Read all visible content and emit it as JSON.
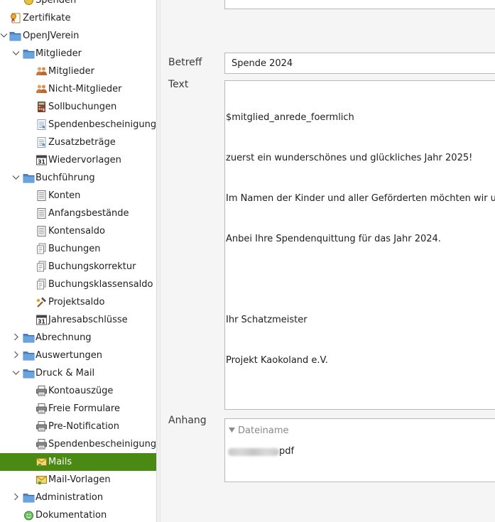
{
  "tree": {
    "items": [
      {
        "id": "spenden",
        "label": "Spenden",
        "icon": "money-icon",
        "level": 1,
        "expander": "none",
        "selected": false
      },
      {
        "id": "zertifikate",
        "label": "Zertifikate",
        "icon": "certificate-icon",
        "level": 0,
        "expander": "none",
        "selected": false
      },
      {
        "id": "openjverein",
        "label": "OpenJVerein",
        "icon": "folder-icon",
        "level": 0,
        "expander": "expanded",
        "selected": false
      },
      {
        "id": "mitglieder-folder",
        "label": "Mitglieder",
        "icon": "folder-icon",
        "level": 1,
        "expander": "expanded",
        "selected": false
      },
      {
        "id": "mitglieder",
        "label": "Mitglieder",
        "icon": "people-icon",
        "level": 2,
        "expander": "none",
        "selected": false
      },
      {
        "id": "nicht-mitglieder",
        "label": "Nicht-Mitglieder",
        "icon": "people-icon",
        "level": 2,
        "expander": "none",
        "selected": false
      },
      {
        "id": "sollbuchungen",
        "label": "Sollbuchungen",
        "icon": "calculator-icon",
        "level": 2,
        "expander": "none",
        "selected": false
      },
      {
        "id": "spendenbescheinigungen-1",
        "label": "Spendenbescheinigungen",
        "icon": "document-icon",
        "level": 2,
        "expander": "none",
        "selected": false
      },
      {
        "id": "zusatzbetraege",
        "label": "Zusatzbeträge",
        "icon": "document-icon",
        "level": 2,
        "expander": "none",
        "selected": false
      },
      {
        "id": "wiedervorlagen",
        "label": "Wiedervorlagen",
        "icon": "calendar-icon",
        "level": 2,
        "expander": "none",
        "selected": false
      },
      {
        "id": "buchfuehrung",
        "label": "Buchführung",
        "icon": "folder-icon",
        "level": 1,
        "expander": "expanded",
        "selected": false
      },
      {
        "id": "konten",
        "label": "Konten",
        "icon": "ledger-icon",
        "level": 2,
        "expander": "none",
        "selected": false
      },
      {
        "id": "anfangsbestaende",
        "label": "Anfangsbestände",
        "icon": "ledger-icon",
        "level": 2,
        "expander": "none",
        "selected": false
      },
      {
        "id": "kontensaldo",
        "label": "Kontensaldo",
        "icon": "ledger-icon",
        "level": 2,
        "expander": "none",
        "selected": false
      },
      {
        "id": "buchungen",
        "label": "Buchungen",
        "icon": "pages-icon",
        "level": 2,
        "expander": "none",
        "selected": false
      },
      {
        "id": "buchungskorrektur",
        "label": "Buchungskorrektur",
        "icon": "pages-icon",
        "level": 2,
        "expander": "none",
        "selected": false
      },
      {
        "id": "buchungsklassensaldo",
        "label": "Buchungsklassensaldo",
        "icon": "pages-icon",
        "level": 2,
        "expander": "none",
        "selected": false
      },
      {
        "id": "projektsaldo",
        "label": "Projektsaldo",
        "icon": "hammer-icon",
        "level": 2,
        "expander": "none",
        "selected": false
      },
      {
        "id": "jahresabschluesse",
        "label": "Jahresabschlüsse",
        "icon": "calendar-icon",
        "level": 2,
        "expander": "none",
        "selected": false
      },
      {
        "id": "abrechnung",
        "label": "Abrechnung",
        "icon": "folder-icon",
        "level": 1,
        "expander": "collapsed",
        "selected": false
      },
      {
        "id": "auswertungen",
        "label": "Auswertungen",
        "icon": "folder-icon",
        "level": 1,
        "expander": "collapsed",
        "selected": false
      },
      {
        "id": "druck-mail",
        "label": "Druck & Mail",
        "icon": "folder-icon",
        "level": 1,
        "expander": "expanded",
        "selected": false
      },
      {
        "id": "kontoauszuege",
        "label": "Kontoauszüge",
        "icon": "printer-icon",
        "level": 2,
        "expander": "none",
        "selected": false
      },
      {
        "id": "freie-formulare",
        "label": "Freie Formulare",
        "icon": "printer-icon",
        "level": 2,
        "expander": "none",
        "selected": false
      },
      {
        "id": "pre-notification",
        "label": "Pre-Notification",
        "icon": "printer-icon",
        "level": 2,
        "expander": "none",
        "selected": false
      },
      {
        "id": "spendenbescheinigungen-2",
        "label": "Spendenbescheinigungen",
        "icon": "printer-icon",
        "level": 2,
        "expander": "none",
        "selected": false
      },
      {
        "id": "mails",
        "label": "Mails",
        "icon": "mail-icon",
        "level": 2,
        "expander": "none",
        "selected": true
      },
      {
        "id": "mail-vorlagen",
        "label": "Mail-Vorlagen",
        "icon": "mail-icon",
        "level": 2,
        "expander": "none",
        "selected": false
      },
      {
        "id": "administration",
        "label": "Administration",
        "icon": "folder-icon",
        "level": 1,
        "expander": "collapsed",
        "selected": false
      },
      {
        "id": "dokumentation",
        "label": "Dokumentation",
        "icon": "help-icon",
        "level": 1,
        "expander": "none",
        "selected": false
      }
    ]
  },
  "form": {
    "betreff_label": "Betreff",
    "betreff_value": "Spende 2024",
    "text_label": "Text",
    "text_lines": [
      "$mitglied_anrede_foermlich",
      "zuerst ein wunderschönes und glückliches Jahr 2025!",
      "Im Namen der Kinder und aller Geförderten möchten wir uns",
      "Anbei Ihre Spendenquittung für das Jahr 2024.",
      "",
      "Ihr Schatzmeister",
      "Projekt Kaokoland e.V."
    ],
    "anhang_label": "Anhang",
    "anhang_column": "Dateiname",
    "attachment_suffix": "pdf"
  },
  "colors": {
    "selection": "#4a8a12",
    "folder": "#4a86c8"
  }
}
